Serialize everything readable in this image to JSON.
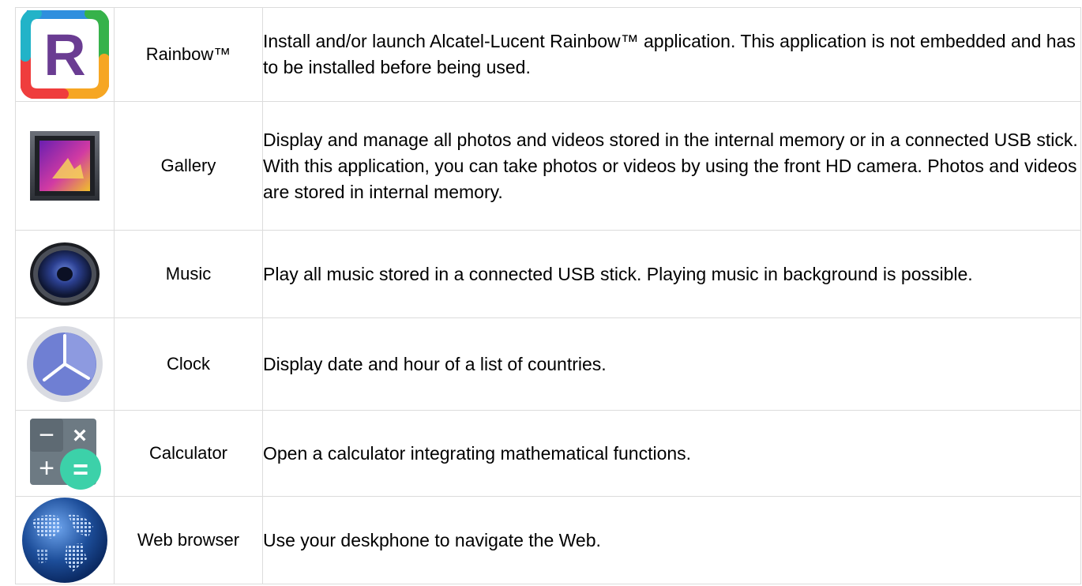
{
  "apps": [
    {
      "name": "Rainbow™",
      "icon": "rainbow-icon",
      "description": "Install and/or launch Alcatel-Lucent Rainbow™ application. This application is not embedded and has to be installed before being used."
    },
    {
      "name": "Gallery",
      "icon": "gallery-icon",
      "description": "Display and manage all photos and videos stored in the internal memory or in a connected USB stick. With this application, you can take photos or videos by using the front HD camera. Photos and videos are stored in internal memory."
    },
    {
      "name": "Music",
      "icon": "speaker-icon",
      "description": "Play all music stored in a connected USB stick. Playing music in background is possible."
    },
    {
      "name": "Clock",
      "icon": "clock-icon",
      "description": "Display date and hour of a list of countries."
    },
    {
      "name": "Calculator",
      "icon": "calculator-icon",
      "description": "Open a calculator integrating mathematical functions."
    },
    {
      "name": "Web browser",
      "icon": "globe-icon",
      "description": "Use your deskphone to navigate the Web."
    }
  ],
  "icon_glyphs": {
    "rainbow": "R",
    "minus": "−",
    "times": "×",
    "plus": "+",
    "equals": "="
  },
  "colors": {
    "border": "#dcdcdc",
    "rainbow_letter": "#6a3c92",
    "clock_face": "#6f7fd3",
    "calculator_equals": "#3cd1a9",
    "globe": "#1d4e9a"
  }
}
